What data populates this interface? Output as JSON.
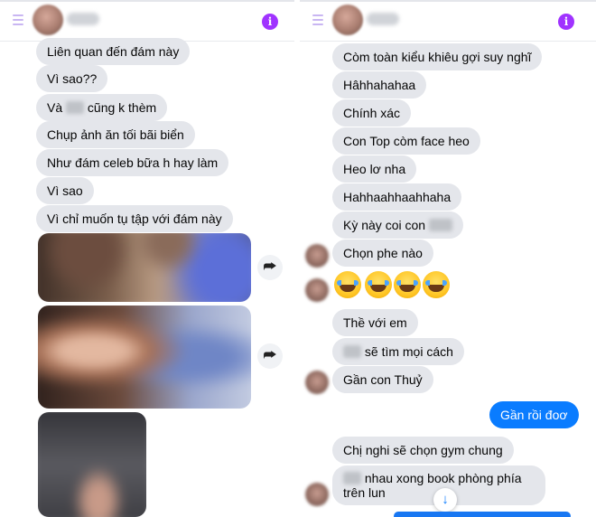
{
  "left_chat": {
    "messages": [
      "Liên quan đến đám này",
      "Vì sao??",
      "Và",
      "cũng k thèm",
      "Chụp ảnh ăn tối bãi biển",
      "Như đám celeb bữa h hay làm",
      "Vì sao",
      "Vì chỉ muốn tụ tập với đám này"
    ],
    "share_icon": "share-icon"
  },
  "right_chat": {
    "messages": [
      "Còm toàn kiểu khiêu gợi suy nghĩ",
      "Hâhhahahaa",
      "Chính xác",
      "Con Top còm face heo",
      "Heo lơ nha",
      "Hahhaahhaahhaha",
      "Kỳ này coi con",
      "Chọn phe nào",
      "Thề với em",
      "sẽ tìm mọi cách",
      "Gần con Thuỷ",
      "Gần rồi đoơ",
      "Chị nghi sẽ chọn gym chung",
      "nhau xong book phòng phía trên lun"
    ],
    "emoji": [
      "😂",
      "😂",
      "😂",
      "😂"
    ]
  },
  "icons": {
    "info": "i",
    "share": "⮫",
    "scroll_down": "↓"
  },
  "colors": {
    "incoming_bubble": "#e4e6eb",
    "outgoing_bubble": "#0a7cff",
    "info_icon": "#a033ff"
  }
}
